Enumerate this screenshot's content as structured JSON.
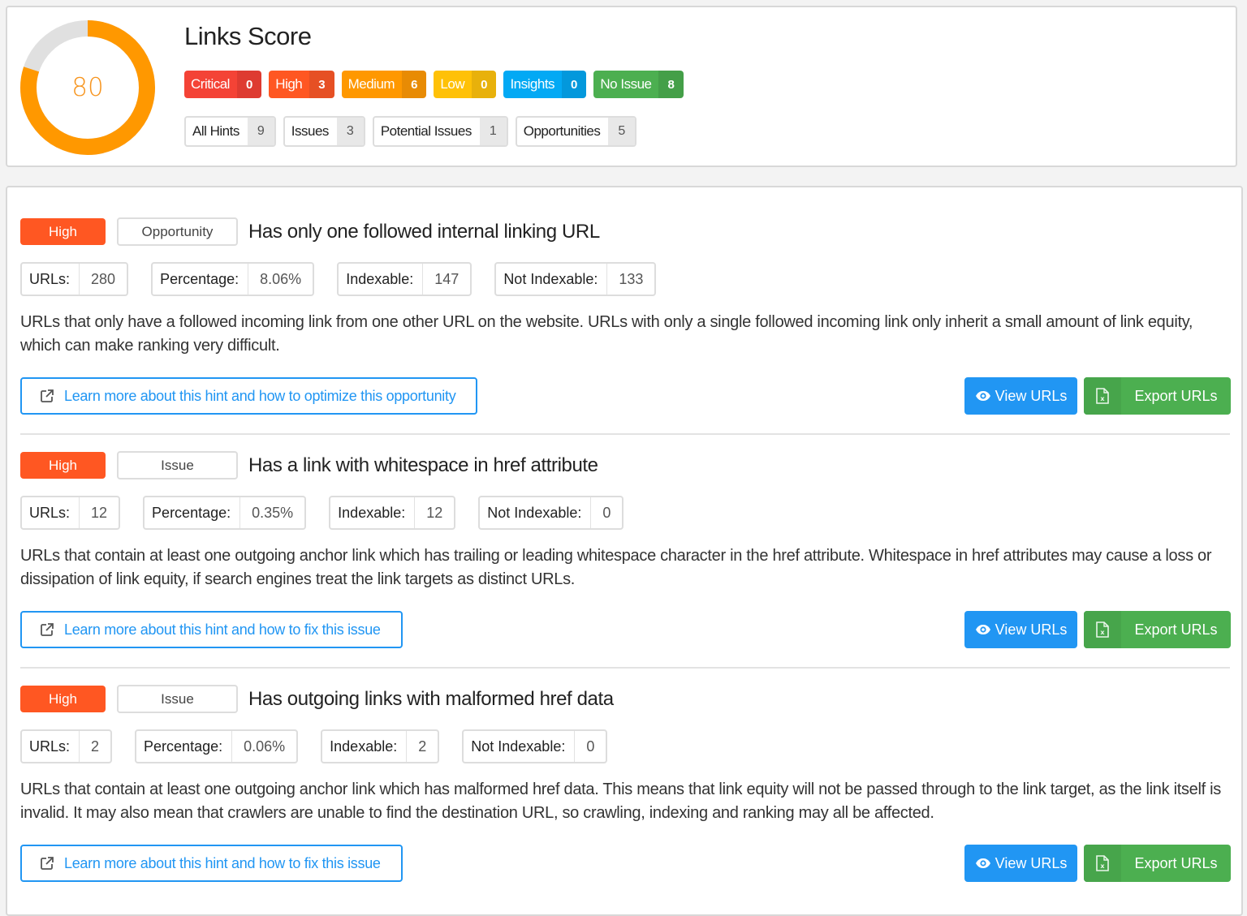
{
  "score": {
    "title": "Links Score",
    "value": "80",
    "percent": 80,
    "colors": {
      "progress": "#ff9800",
      "track": "#e0e0e0"
    }
  },
  "severity_badges": [
    {
      "label": "Critical",
      "count": "0",
      "color": "#f44336",
      "count_color": "#de3b31"
    },
    {
      "label": "High",
      "count": "3",
      "color": "#ff5722",
      "count_color": "#e65024"
    },
    {
      "label": "Medium",
      "count": "6",
      "color": "#ff9800",
      "count_color": "#e88b04"
    },
    {
      "label": "Low",
      "count": "0",
      "color": "#ffc107",
      "count_color": "#e8b10b"
    },
    {
      "label": "Insights",
      "count": "0",
      "color": "#03a9f4",
      "count_color": "#0398dc"
    },
    {
      "label": "No Issue",
      "count": "8",
      "color": "#4caf50",
      "count_color": "#449f48"
    }
  ],
  "hint_filters": [
    {
      "label": "All Hints",
      "count": "9"
    },
    {
      "label": "Issues",
      "count": "3"
    },
    {
      "label": "Potential Issues",
      "count": "1"
    },
    {
      "label": "Opportunities",
      "count": "5"
    }
  ],
  "hints": [
    {
      "priority": "High",
      "type": "Opportunity",
      "title": "Has only one followed internal linking URL",
      "stats": [
        {
          "key": "URLs:",
          "value": "280"
        },
        {
          "key": "Percentage:",
          "value": "8.06%"
        },
        {
          "key": "Indexable:",
          "value": "147"
        },
        {
          "key": "Not Indexable:",
          "value": "133"
        }
      ],
      "description": "URLs that only have a followed incoming link from one other URL on the website. URLs with only a single followed incoming link only inherit a small amount of link equity, which can make ranking very difficult.",
      "learn_more": "Learn more about this hint and how to optimize this opportunity",
      "view_label": "View URLs",
      "export_label": "Export URLs"
    },
    {
      "priority": "High",
      "type": "Issue",
      "title": "Has a link with whitespace in href attribute",
      "stats": [
        {
          "key": "URLs:",
          "value": "12"
        },
        {
          "key": "Percentage:",
          "value": "0.35%"
        },
        {
          "key": "Indexable:",
          "value": "12"
        },
        {
          "key": "Not Indexable:",
          "value": "0"
        }
      ],
      "description": "URLs that contain at least one outgoing anchor link which has trailing or leading whitespace character in the href attribute. Whitespace in href attributes may cause a loss or dissipation of link equity, if search engines treat the link targets as distinct URLs.",
      "learn_more": "Learn more about this hint and how to fix this issue",
      "view_label": "View URLs",
      "export_label": "Export URLs"
    },
    {
      "priority": "High",
      "type": "Issue",
      "title": "Has outgoing links with malformed href data",
      "stats": [
        {
          "key": "URLs:",
          "value": "2"
        },
        {
          "key": "Percentage:",
          "value": "0.06%"
        },
        {
          "key": "Indexable:",
          "value": "2"
        },
        {
          "key": "Not Indexable:",
          "value": "0"
        }
      ],
      "description": "URLs that contain at least one outgoing anchor link which has malformed href data. This means that link equity will not be passed through to the link target, as the link itself is invalid. It may also mean that crawlers are unable to find the destination URL, so crawling, indexing and ranking may all be affected.",
      "learn_more": "Learn more about this hint and how to fix this issue",
      "view_label": "View URLs",
      "export_label": "Export URLs"
    }
  ]
}
